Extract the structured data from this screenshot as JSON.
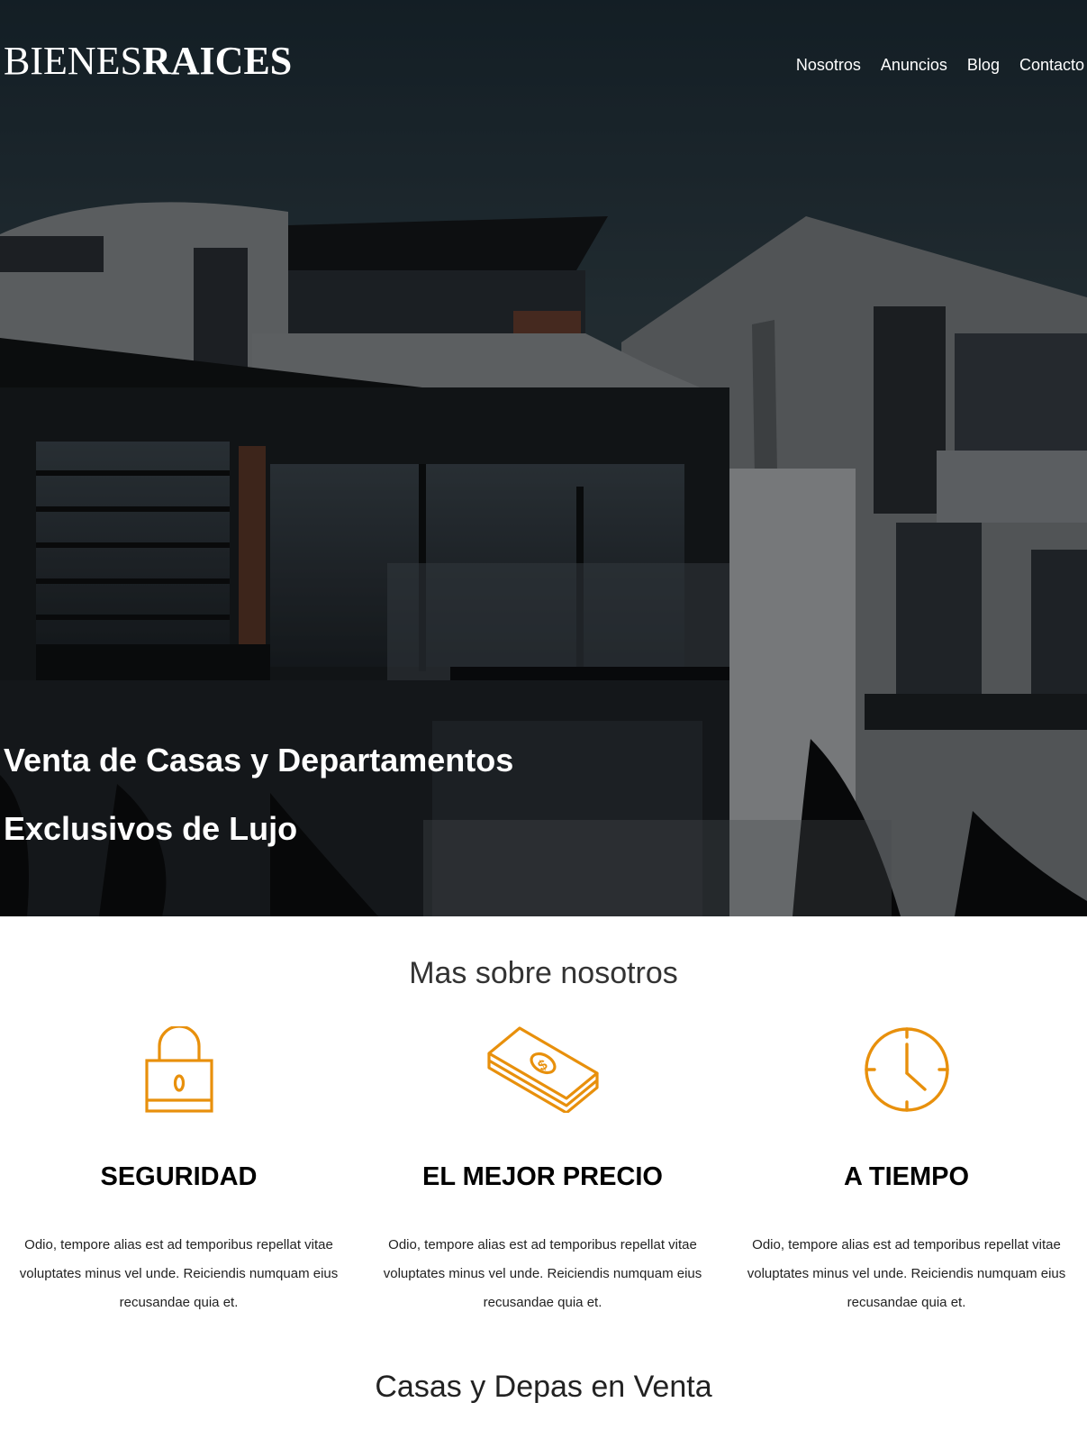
{
  "header": {
    "logo_light": "BIENES",
    "logo_bold": "RAICES",
    "nav": [
      "Nosotros",
      "Anuncios",
      "Blog",
      "Contacto"
    ]
  },
  "hero": {
    "title_line1": "Venta de Casas y Departamentos",
    "title_line2": "Exclusivos de Lujo"
  },
  "about": {
    "title": "Mas sobre nosotros",
    "features": [
      {
        "icon": "lock-icon",
        "title": "SEGURIDAD",
        "text": "Odio, tempore alias est ad temporibus repellat vitae voluptates minus vel unde. Reiciendis numquam eius recusandae quia et."
      },
      {
        "icon": "money-icon",
        "title": "EL MEJOR PRECIO",
        "text": "Odio, tempore alias est ad temporibus repellat vitae voluptates minus vel unde. Reiciendis numquam eius recusandae quia et."
      },
      {
        "icon": "clock-icon",
        "title": "A TIEMPO",
        "text": "Odio, tempore alias est ad temporibus repellat vitae voluptates minus vel unde. Reiciendis numquam eius recusandae quia et."
      }
    ]
  },
  "listings": {
    "title": "Casas y Depas en Venta"
  },
  "colors": {
    "accent": "#e8900c",
    "text": "#000000"
  }
}
